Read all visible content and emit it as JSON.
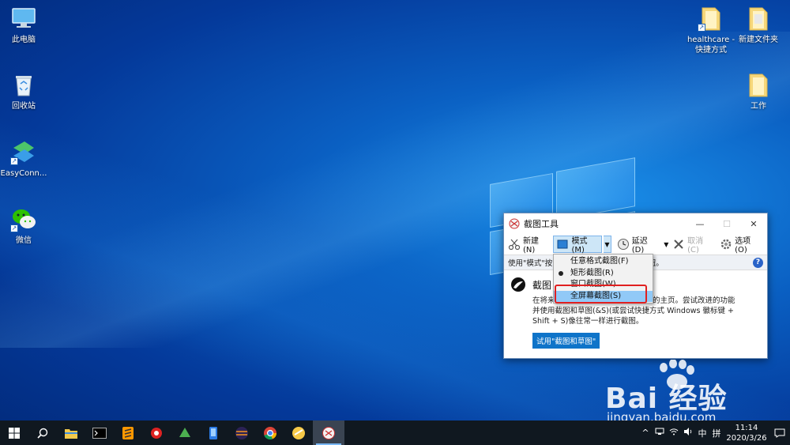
{
  "desktop": {
    "icons_left": [
      {
        "label": "此电脑",
        "icon": "computer-icon"
      },
      {
        "label": "回收站",
        "icon": "recycle-bin-icon"
      },
      {
        "label": "EasyConn...",
        "icon": "easyconnect-icon"
      },
      {
        "label": "微信",
        "icon": "wechat-icon"
      }
    ],
    "icons_right": [
      {
        "label_line1": "healthcare -",
        "label_line2": "快捷方式",
        "icon": "folder-shortcut-icon"
      },
      {
        "label_line1": "新建文件夹",
        "label_line2": "",
        "icon": "folder-icon"
      },
      {
        "label_line1": "工作",
        "label_line2": "",
        "icon": "folder-icon"
      }
    ]
  },
  "snipping_tool": {
    "title": "截图工具",
    "toolbar": {
      "new_label": "新建(N)",
      "mode_label": "模式(M)",
      "delay_label": "延迟(D)",
      "cancel_label": "取消(C)",
      "options_label": "选项(O)"
    },
    "hint_left": "使用\"模式\"按",
    "hint_right": "按钮。",
    "body_heading": "截图",
    "body_text_line1": "在将来的更新中，截图工具将移到新的主页。尝试改进的功能",
    "body_text_line2": "并使用截图和草图(&S)(或尝试快捷方式 Windows 徽标键 +",
    "body_text_line3": "Shift + S)像往常一样进行截图。",
    "try_button": "试用\"截图和草图\""
  },
  "mode_menu": {
    "items": [
      "任意格式截图(F)",
      "矩形截图(R)",
      "窗口截图(W)",
      "全屏幕截图(S)"
    ],
    "selected_index": 1,
    "highlighted_index": 3
  },
  "taskbar": {
    "input_method": "中",
    "keyboard_layout": "拼",
    "time": "11:14",
    "date": "2020/3/26"
  },
  "watermark": {
    "brand": "Bai 经验",
    "url": "jingyan.baidu.com"
  }
}
